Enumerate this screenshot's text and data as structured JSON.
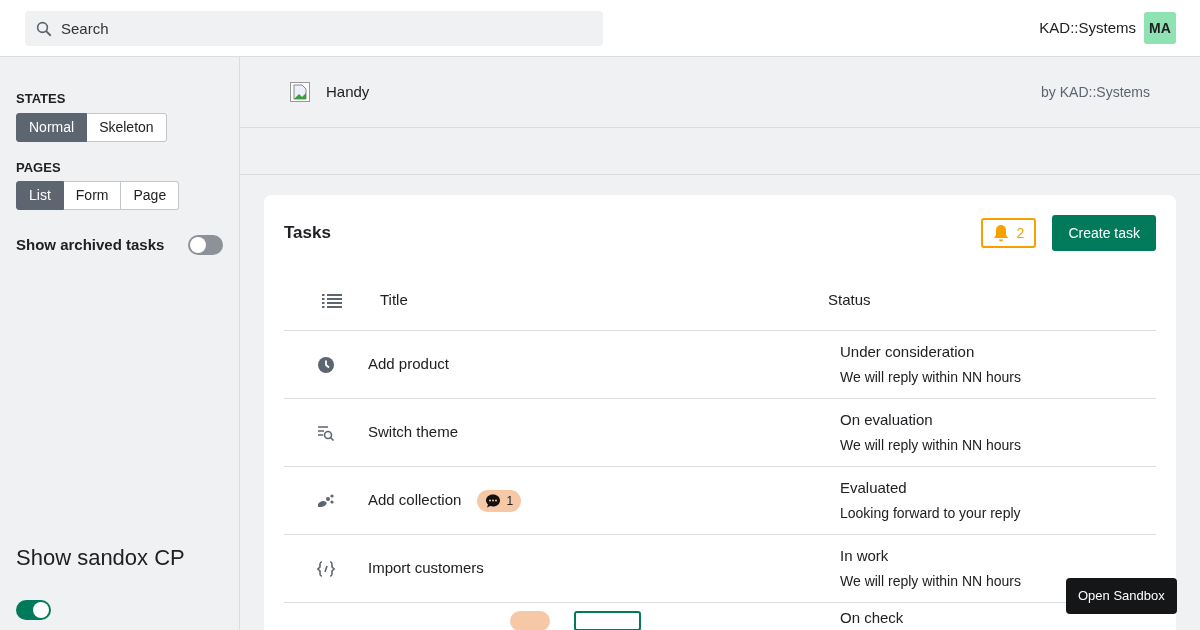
{
  "search": {
    "placeholder": "Search"
  },
  "header": {
    "company": "KAD::Systems",
    "avatar": "MA"
  },
  "sidebar": {
    "groups": [
      {
        "heading": "STATES",
        "options": [
          {
            "label": "Normal",
            "selected": true
          },
          {
            "label": "Skeleton",
            "selected": false
          }
        ]
      },
      {
        "heading": "PAGES",
        "options": [
          {
            "label": "List",
            "selected": true
          },
          {
            "label": "Form",
            "selected": false
          },
          {
            "label": "Page",
            "selected": false
          }
        ]
      }
    ],
    "archived_toggle": {
      "label": "Show archived tasks",
      "on": false
    },
    "sandbox_toggle": {
      "label": "Show sandox CP",
      "on": true
    }
  },
  "app": {
    "name": "Handy",
    "byline": "by KAD::Systems"
  },
  "tasks": {
    "title": "Tasks",
    "notifications": "2",
    "create_button": "Create task",
    "columns": [
      "Title",
      "Status"
    ],
    "rows": [
      {
        "kind": "clock",
        "title": "Add product",
        "status": "Under consideration",
        "note": "We will reply within NN hours"
      },
      {
        "kind": "search-list",
        "title": "Switch theme",
        "status": "On evaluation",
        "note": "We will reply within NN hours"
      },
      {
        "kind": "dots",
        "title": "Add collection",
        "comments": "1",
        "status": "Evaluated",
        "note": "Looking forward to your reply"
      },
      {
        "kind": "code",
        "title": "Import customers",
        "status": "In work",
        "note": "We will reply within NN hours"
      },
      {
        "kind": "cut",
        "has_comments": true,
        "has_tag": true,
        "status": "On check"
      }
    ]
  },
  "tooltip": "Open Sandbox"
}
